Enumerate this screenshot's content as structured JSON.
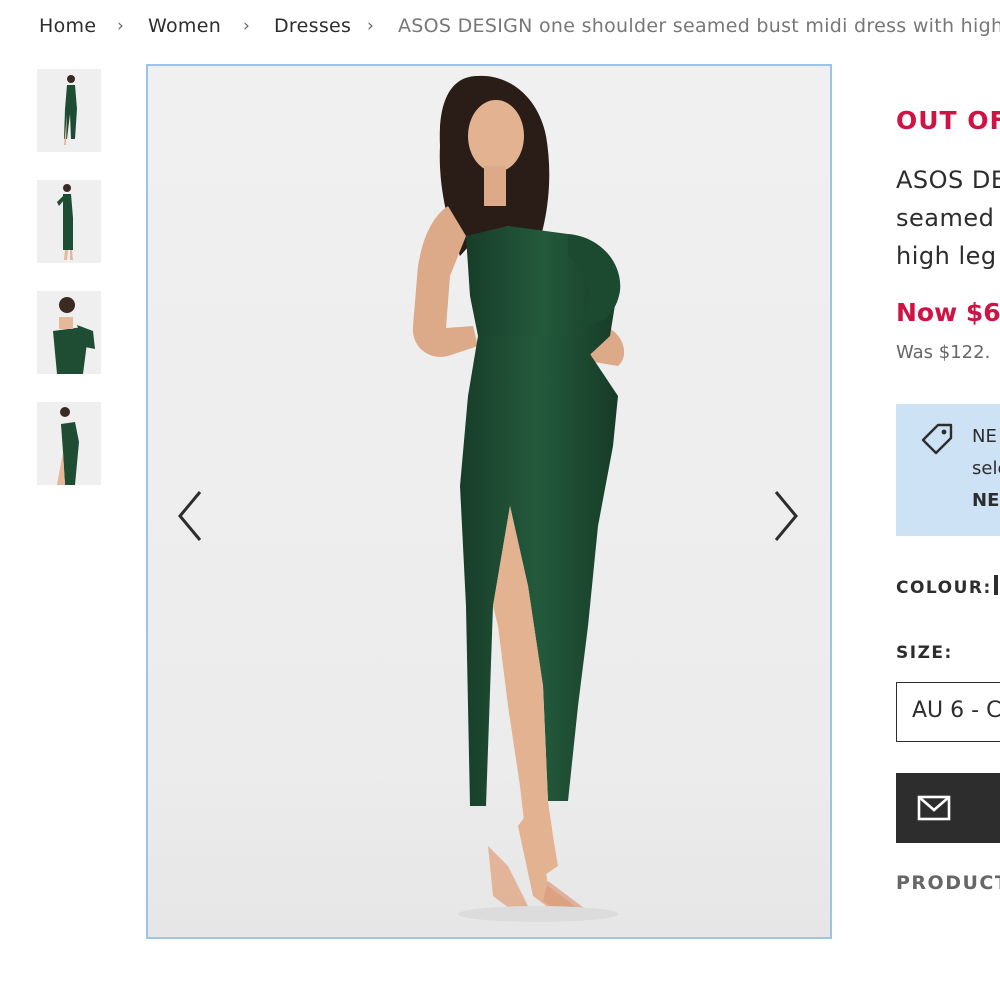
{
  "breadcrumb": {
    "home": "Home",
    "women": "Women",
    "dresses": "Dresses",
    "separator": "›",
    "current": "ASOS DESIGN one shoulder seamed bust midi dress with high l"
  },
  "gallery": {
    "thumbnails": [
      "thumbnail-1",
      "thumbnail-2",
      "thumbnail-3",
      "thumbnail-4"
    ],
    "prev_icon": "chevron-left-icon",
    "next_icon": "chevron-right-icon"
  },
  "product": {
    "stock_status": "OUT OF",
    "title_lines": [
      "ASOS DE",
      "seamed b",
      "high leg"
    ],
    "now_price": "Now $6",
    "was_price": "Was $122."
  },
  "promo": {
    "icon": "price-tag-icon",
    "lines": [
      "NE",
      "sele",
      "NE"
    ]
  },
  "colour": {
    "label": "COLOUR:"
  },
  "size": {
    "label": "SIZE:",
    "selected": "AU 6 - C"
  },
  "notify": {
    "icon": "mail-icon"
  },
  "details": {
    "label": "PRODUCT"
  },
  "colors": {
    "sale": "#d01345",
    "promo_bg": "#cde2f5",
    "dark": "#2d2d2d",
    "dress": "#1f4d33"
  }
}
